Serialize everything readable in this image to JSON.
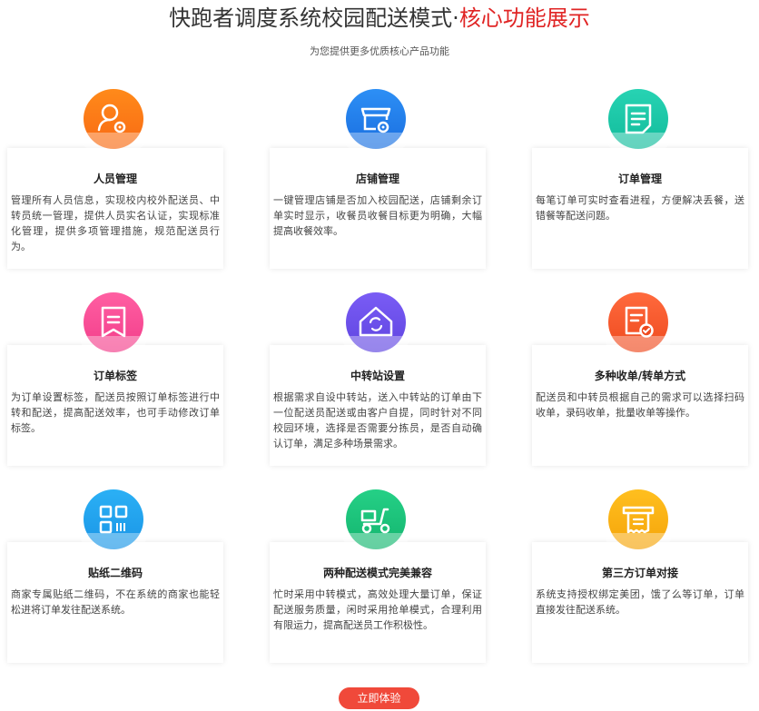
{
  "header": {
    "title_main": "快跑者调度系统校园配送模式·",
    "title_accent": "核心功能展示",
    "subtitle": "为您提供更多优质核心产品功能"
  },
  "colors": {
    "accent": "#e02424",
    "button": "#f0493a"
  },
  "features": [
    {
      "icon": "user-gear-icon",
      "title": "人员管理",
      "desc": "管理所有人员信息，实现校内校外配送员、中转员统一管理，提供人员实名认证，实现标准化管理，提供多项管理措施，规范配送员行为。"
    },
    {
      "icon": "store-gear-icon",
      "title": "店铺管理",
      "desc": "一键管理店铺是否加入校园配送，店铺剩余订单实时显示，收餐员收餐目标更为明确，大幅提高收餐效率。"
    },
    {
      "icon": "order-document-icon",
      "title": "订单管理",
      "desc": "每笔订单可实时查看进程，方便解决丢餐，送错餐等配送问题。"
    },
    {
      "icon": "bookmark-tag-icon",
      "title": "订单标签",
      "desc": "为订单设置标签，配送员按照订单标签进行中转和配送，提高配送效率，也可手动修改订单标签。"
    },
    {
      "icon": "house-transfer-icon",
      "title": "中转站设置",
      "desc": "根据需求自设中转站，送入中转站的订单由下一位配送员配送或由客户自提，同时针对不同校园环境，选择是否需要分拣员，是否自动确认订单，满足多种场景需求。"
    },
    {
      "icon": "document-check-icon",
      "title": "多种收单/转单方式",
      "desc": "配送员和中转员根据自己的需求可以选择扫码收单，录码收单，批量收单等操作。"
    },
    {
      "icon": "qr-code-icon",
      "title": "贴纸二维码",
      "desc": "商家专属贴纸二维码，不在系统的商家也能轻松进将订单发往配送系统。"
    },
    {
      "icon": "scooter-icon",
      "title": "两种配送模式完美兼容",
      "desc": "忙时采用中转模式，高效处理大量订单，保证配送服务质量，闲时采用抢单模式，合理利用有限运力，提高配送员工作积极性。"
    },
    {
      "icon": "receipt-printer-icon",
      "title": "第三方订单对接",
      "desc": "系统支持授权绑定美团，饿了么等订单，订单直接发往配送系统。"
    }
  ],
  "cta": {
    "label": "立即体验"
  }
}
